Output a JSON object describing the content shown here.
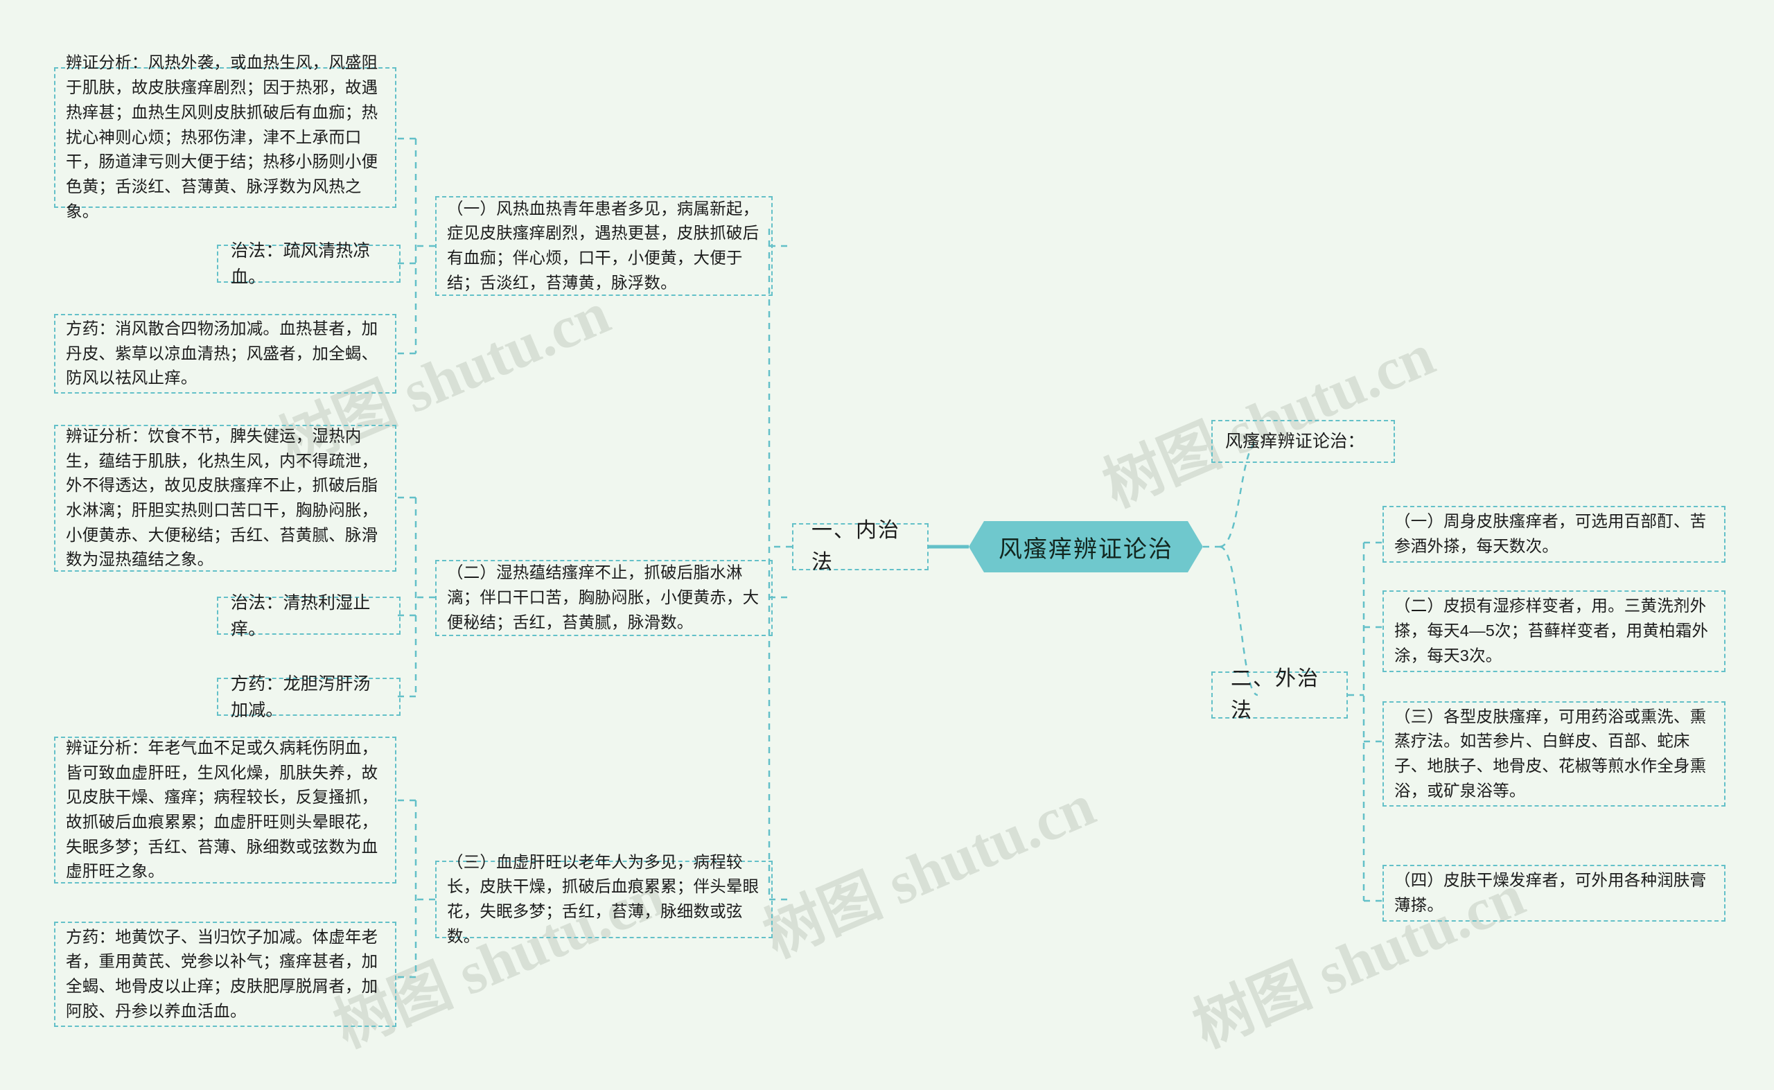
{
  "root": {
    "title": "风瘙痒辨证论治",
    "accent_color": "#6fc8cd",
    "background_color": "#f0f7ef",
    "border_color": "#63c0c8"
  },
  "watermarks": [
    "树图 shutu.cn",
    "树图 shutu.cn",
    "树图 shutu.cn",
    "树图 shutu.cn",
    "树图 shutu.cn"
  ],
  "branches": {
    "internal": "一、内治法",
    "external": "二、外治法"
  },
  "external_heading": "风瘙痒辨证论治：",
  "internal_sections": [
    {
      "analysis": "辨证分析：风热外袭，或血热生风，风盛阻于肌肤，故皮肤瘙痒剧烈；因于热邪，故遇热痒甚；血热生风则皮肤抓破后有血痂；热扰心神则心烦；热邪伤津，津不上承而口干，肠道津亏则大便于结；热移小肠则小便色黄；舌淡红、苔薄黄、脉浮数为风热之象。",
      "syndrome": "（一）风热血热青年患者多见，病属新起，症见皮肤瘙痒剧烈，遇热更甚，皮肤抓破后有血痂；伴心烦，口干，小便黄，大便于结；舌淡红，苔薄黄，脉浮数。",
      "treatment": "治法：疏风清热凉血。",
      "formula": "方药：消风散合四物汤加减。血热甚者，加丹皮、紫草以凉血清热；风盛者，加全蝎、防风以祛风止痒。"
    },
    {
      "analysis": "辨证分析：饮食不节，脾失健运，湿热内生，蕴结于肌肤，化热生风，内不得疏泄，外不得透达，故见皮肤瘙痒不止，抓破后脂水淋漓；肝胆实热则口苦口干，胸胁闷胀，小便黄赤、大便秘结；舌红、苔黄腻、脉滑数为湿热蕴结之象。",
      "syndrome": "（二）湿热蕴结瘙痒不止，抓破后脂水淋漓；伴口干口苦，胸胁闷胀，小便黄赤，大便秘结；舌红，苔黄腻，脉滑数。",
      "treatment": "治法：清热利湿止痒。",
      "formula": "方药：龙胆泻肝汤加减。"
    },
    {
      "analysis": "辨证分析：年老气血不足或久病耗伤阴血，皆可致血虚肝旺，生风化燥，肌肤失养，故见皮肤干燥、瘙痒；病程较长，反复搔抓，故抓破后血痕累累；血虚肝旺则头晕眼花，失眠多梦；舌红、苔薄、脉细数或弦数为血虚肝旺之象。",
      "syndrome": "（三）血虚肝旺以老年人为多见，病程较长，皮肤干燥，抓破后血痕累累；伴头晕眼花，失眠多梦；舌红，苔薄，脉细数或弦数。",
      "formula": "方药：地黄饮子、当归饮子加减。体虚年老者，重用黄芪、党参以补气；瘙痒甚者，加全蝎、地骨皮以止痒；皮肤肥厚脱屑者，加阿胶、丹参以养血活血。"
    }
  ],
  "external_items": [
    "（一）周身皮肤瘙痒者，可选用百部酊、苦参酒外搽，每天数次。",
    "（二）皮损有湿疹样变者，用。三黄洗剂外搽，每天4—5次；苔藓样变者，用黄柏霜外涂，每天3次。",
    "（三）各型皮肤瘙痒，可用药浴或熏洗、熏蒸疗法。如苦参片、白鲜皮、百部、蛇床子、地肤子、地骨皮、花椒等煎水作全身熏浴，或矿泉浴等。",
    "（四）皮肤干燥发痒者，可外用各种润肤膏薄搽。"
  ]
}
